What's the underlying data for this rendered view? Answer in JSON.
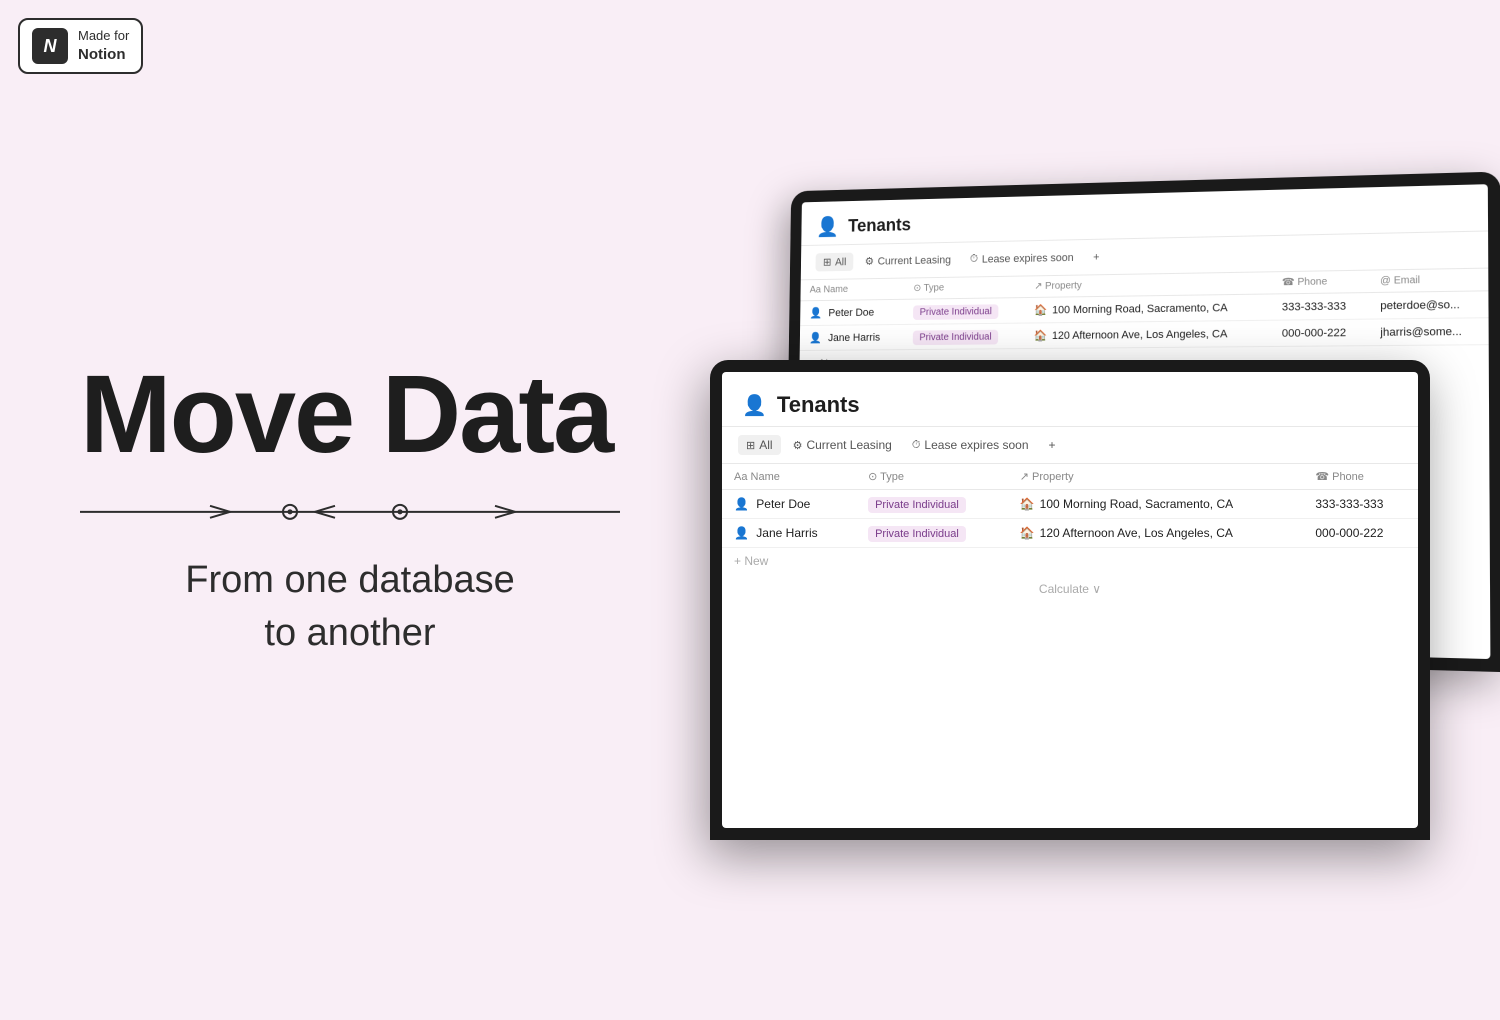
{
  "badge": {
    "icon_text": "N",
    "line1": "Made for",
    "line2": "Notion"
  },
  "hero": {
    "title": "Move Data",
    "subtitle_line1": "From one database",
    "subtitle_line2": "to another"
  },
  "db": {
    "title": "Tenants",
    "tabs": [
      {
        "label": "All",
        "icon": "⊞",
        "active": true
      },
      {
        "label": "Current Leasing",
        "icon": "⚙"
      },
      {
        "label": "Lease expires soon",
        "icon": "⏱"
      },
      {
        "label": "+",
        "icon": ""
      }
    ],
    "columns": [
      "Aa Name",
      "⊙ Type",
      "↗ Property",
      "☎ Phone",
      "@ Email"
    ],
    "rows": [
      {
        "name": "Peter Doe",
        "type": "Private Individual",
        "property": "100 Morning Road, Sacramento, CA",
        "phone": "333-333-333",
        "email": "peterdoe@so..."
      },
      {
        "name": "Jane Harris",
        "type": "Private Individual",
        "property": "120 Afternoon Ave, Los Angeles, CA",
        "phone": "000-000-222",
        "email": "jharris@some..."
      }
    ],
    "new_label": "+ New",
    "calculate_label": "Calculate ∨"
  }
}
